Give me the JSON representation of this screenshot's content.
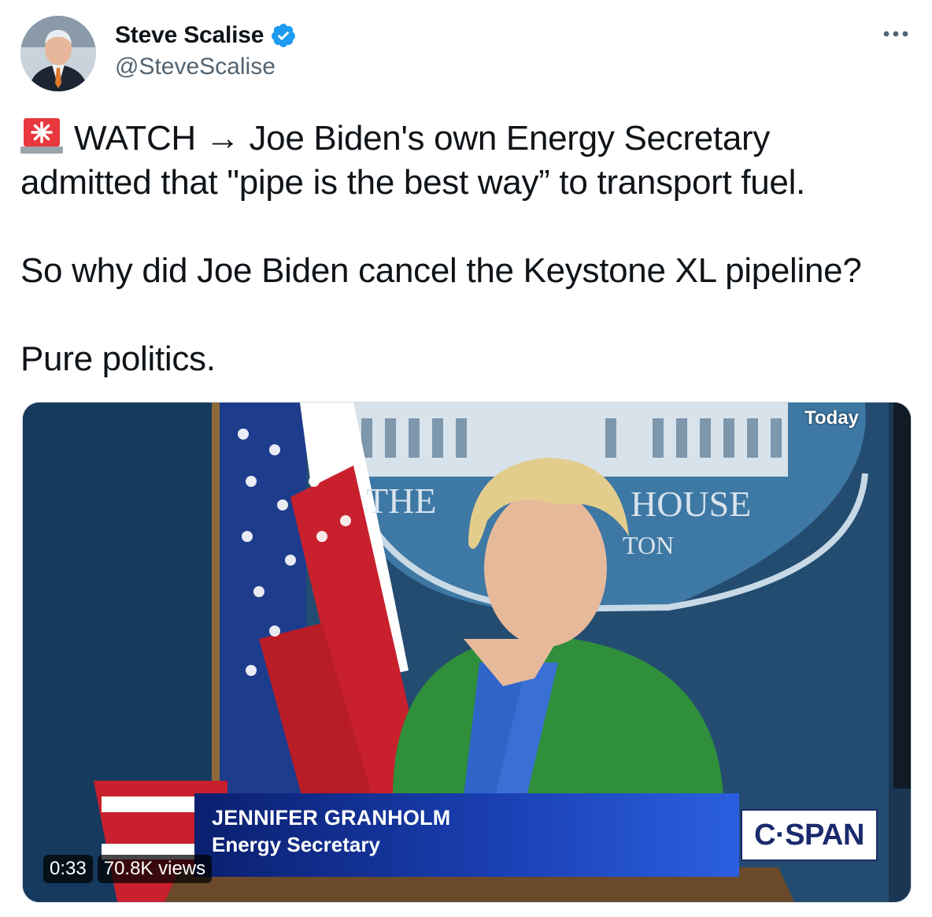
{
  "author": {
    "name": "Steve Scalise",
    "handle": "@SteveScalise"
  },
  "tweet": {
    "line1": "WATCH → Joe Biden's own Energy Secretary admitted that \"pipe is the best way” to transport fuel.",
    "line2": "So why did Joe Biden cancel the Keystone XL pipeline?",
    "line3": "Pure politics."
  },
  "video": {
    "channel_tag": "Today",
    "lower_third_name": "JENNIFER GRANHOLM",
    "lower_third_title": "Energy Secretary",
    "logo_text": "C·SPAN",
    "seal_text_left": "THE",
    "seal_text_right": "HOUSE",
    "seal_text_bottom": "TON",
    "duration": "0:33",
    "views": "70.8K views"
  },
  "colors": {
    "text": "#0f1419",
    "secondary": "#536471",
    "verified": "#1d9bf0"
  },
  "icons": [
    "verified-badge-icon",
    "more-options-icon",
    "siren-emoji-icon",
    "arrow-right"
  ]
}
